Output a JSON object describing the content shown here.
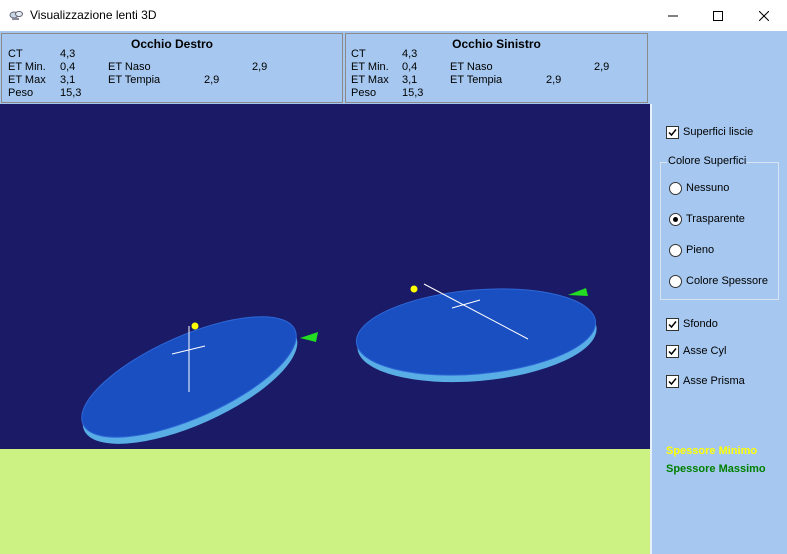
{
  "window": {
    "title": "Visualizzazione lenti 3D"
  },
  "right_eye": {
    "title": "Occhio Destro",
    "ct_label": "CT",
    "ct_value": "4,3",
    "et_min_label": "ET Min.",
    "et_min_value": "0,4",
    "et_max_label": "ET Max",
    "et_max_value": "3,1",
    "peso_label": "Peso",
    "peso_value": "15,3",
    "et_naso_label": "ET Naso",
    "et_naso_value": "2,9",
    "et_tempia_label": "ET Tempia",
    "et_tempia_value": "2,9"
  },
  "left_eye": {
    "title": "Occhio Sinistro",
    "ct_label": "CT",
    "ct_value": "4,3",
    "et_min_label": "ET Min.",
    "et_min_value": "0,4",
    "et_max_label": "ET Max",
    "et_max_value": "3,1",
    "peso_label": "Peso",
    "peso_value": "15,3",
    "et_naso_label": "ET Naso",
    "et_naso_value": "2,9",
    "et_tempia_label": "ET Tempia",
    "et_tempia_value": "2,9"
  },
  "options": {
    "superfici_lisce": {
      "label": "Superfici liscie",
      "checked": true
    },
    "colore_superfici": {
      "legend": "Colore Superfici",
      "options": [
        "Nessuno",
        "Trasparente",
        "Pieno",
        "Colore Spessore"
      ],
      "selected": "Trasparente"
    },
    "sfondo": {
      "label": "Sfondo",
      "checked": true
    },
    "asse_cyl": {
      "label": "Asse Cyl",
      "checked": true
    },
    "asse_prisma": {
      "label": "Asse Prisma",
      "checked": true
    }
  },
  "legend": {
    "min_label": "Spessore Minimo",
    "min_color": "#ffff00",
    "max_label": "Spessore Massimo",
    "max_color": "#008000"
  },
  "colors": {
    "viewport_background": "#1a1a66",
    "floor": "#ccf284",
    "lens_face": "#1a4fc2",
    "lens_edge": "#5aaee6",
    "panel_background": "#a6c8f0"
  }
}
